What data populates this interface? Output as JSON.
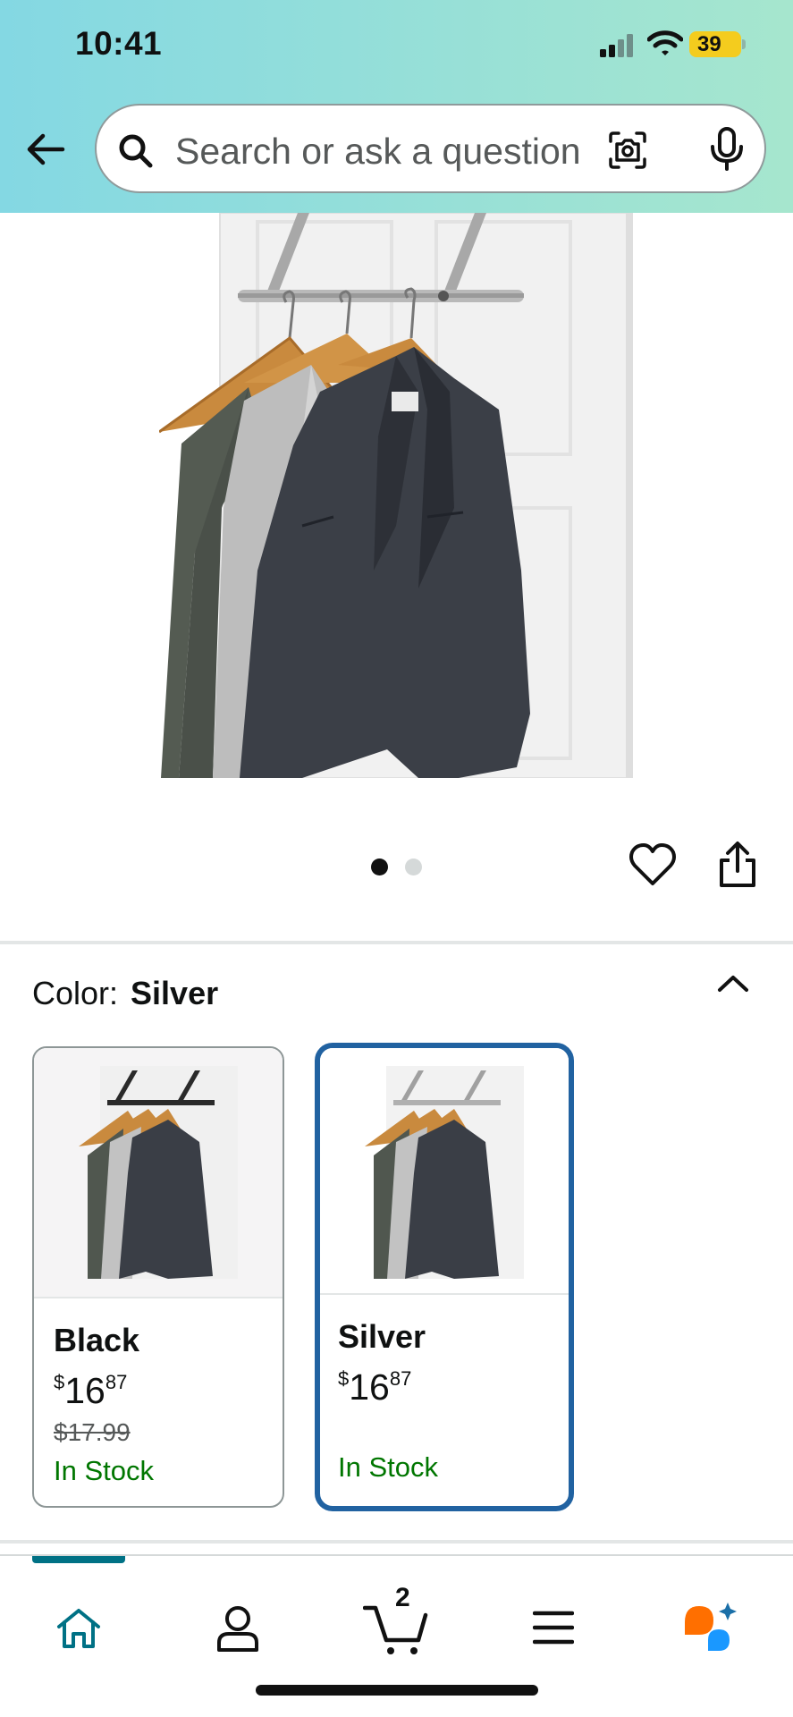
{
  "status_bar": {
    "time": "10:41",
    "battery": "39"
  },
  "search": {
    "placeholder": "Search or ask a question"
  },
  "image_carousel": {
    "pages": 2,
    "active_page": 1
  },
  "variation": {
    "label": "Color:",
    "selected": "Silver",
    "options": [
      {
        "name": "Black",
        "price_symbol": "$",
        "price_whole": "16",
        "price_fraction": "87",
        "was_price": "$17.99",
        "availability": "In Stock",
        "selected": false
      },
      {
        "name": "Silver",
        "price_symbol": "$",
        "price_whole": "16",
        "price_fraction": "87",
        "was_price": "",
        "availability": "In Stock",
        "selected": true
      }
    ]
  },
  "bottom_nav": {
    "items": [
      "home-icon",
      "account-icon",
      "cart-icon",
      "menu-icon",
      "rufus-icon"
    ],
    "cart_count": "2",
    "active": "home"
  },
  "colors": {
    "header_gradient_start": "#84d8e3",
    "header_gradient_end": "#a6e6ce",
    "selected_border": "#2162a1",
    "in_stock": "#007600",
    "nav_active": "#007185",
    "rufus_orange": "#ff6f00",
    "rufus_blue": "#1a98ff"
  }
}
